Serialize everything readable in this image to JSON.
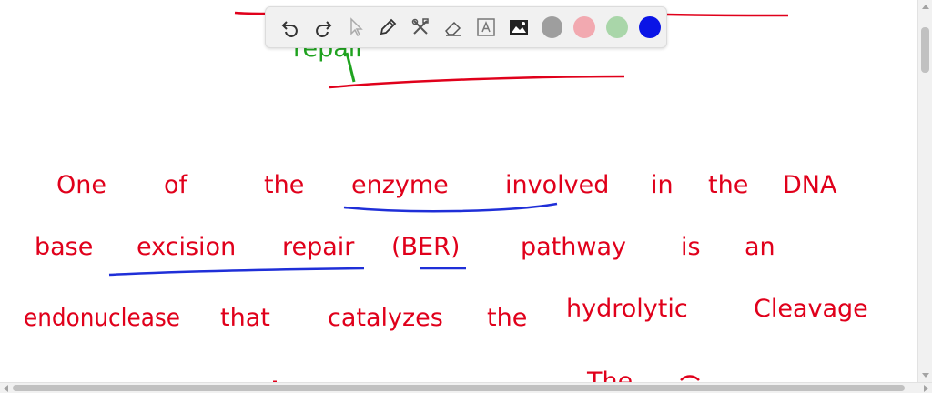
{
  "colors": {
    "ink_red": "#e0001b",
    "ink_green": "#1fa31f",
    "ink_blue": "#1f2fd8",
    "toolbar_bg": "#f1f1f1"
  },
  "toolbar": {
    "tools": [
      {
        "name": "undo-icon"
      },
      {
        "name": "redo-icon"
      },
      {
        "name": "pointer-icon"
      },
      {
        "name": "pen-icon"
      },
      {
        "name": "tools-icon"
      },
      {
        "name": "eraser-icon"
      },
      {
        "name": "text-icon"
      },
      {
        "name": "image-icon"
      }
    ],
    "swatches": [
      "#9e9e9e",
      "#f2a9b0",
      "#a9d6a9",
      "#0a14e6"
    ]
  },
  "notes": {
    "top_word": "repair",
    "line1": [
      "One",
      "of",
      "the",
      "enzyme",
      "involved",
      "in",
      "the",
      "DNA"
    ],
    "line2": [
      "base",
      "excision",
      "repair",
      "(BER)",
      "pathway",
      "is",
      "an"
    ],
    "line3": [
      "endonuclease",
      "that",
      "catalyzes",
      "the",
      "hydrolytic",
      "Cleavage"
    ],
    "line4_partial": "The"
  }
}
